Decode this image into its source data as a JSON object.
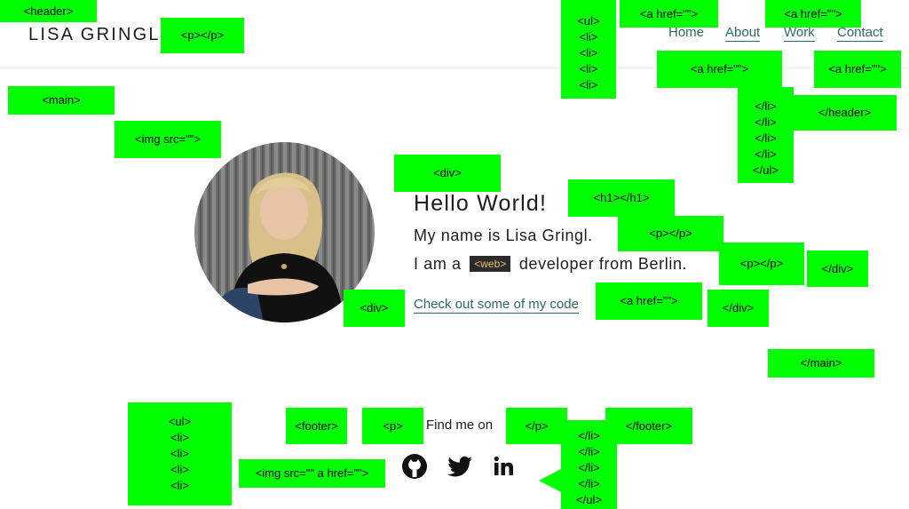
{
  "header": {
    "logo": "LISA GRINGL",
    "nav": [
      "Home",
      "About",
      "Work",
      "Contact"
    ]
  },
  "hero": {
    "avatar_alt": "Portrait of Lisa Gringl",
    "title": "Hello World!",
    "line1": "My name is Lisa Gringl.",
    "line2_before": "I am a",
    "line2_badge": "<web>",
    "line2_after": "developer from Berlin.",
    "link": "Check out some of my code"
  },
  "footer": {
    "find_text": "Find me on",
    "social": [
      "github-icon",
      "twitter-icon",
      "linkedin-icon"
    ]
  },
  "annotations": {
    "header_open": "<header>",
    "p_logo": "<p></p>",
    "ul_lines": [
      "<ul>",
      "<li>",
      "<li>",
      "<li>",
      "<li>"
    ],
    "a_href_1": "<a href=\"\">",
    "a_href_2": "<a href=\"\">",
    "a_href_3": "<a href=\"\">",
    "a_href_4": "<a href=\"\">",
    "li_close_lines": [
      "</li>",
      "</li>",
      "</li>",
      "</li>",
      "</ul>"
    ],
    "header_close": "</header>",
    "main_open": "<main>",
    "img_src": "<img src=\"\">",
    "div_open": "<div>",
    "h1": "<h1></h1>",
    "p_1": "<p></p>",
    "p_2": "<p></p>",
    "div_close_1": "</div>",
    "div_avatar": "<div>",
    "a_href_link": "<a href=\"\">",
    "div_close_2": "</div>",
    "main_close": "</main>",
    "footer_ul_lines": [
      "<ul>",
      "<li>",
      "<li>",
      "<li>",
      "<li>"
    ],
    "footer_open": "<footer>",
    "p_open": "<p>",
    "p_close": "</p>",
    "footer_close": "</footer>",
    "img_src_href": "<img src=\"\" a href=\"\">",
    "footer_li_close_lines": [
      "</li>",
      "</li>",
      "</li>",
      "</li>",
      "</ul>"
    ]
  }
}
